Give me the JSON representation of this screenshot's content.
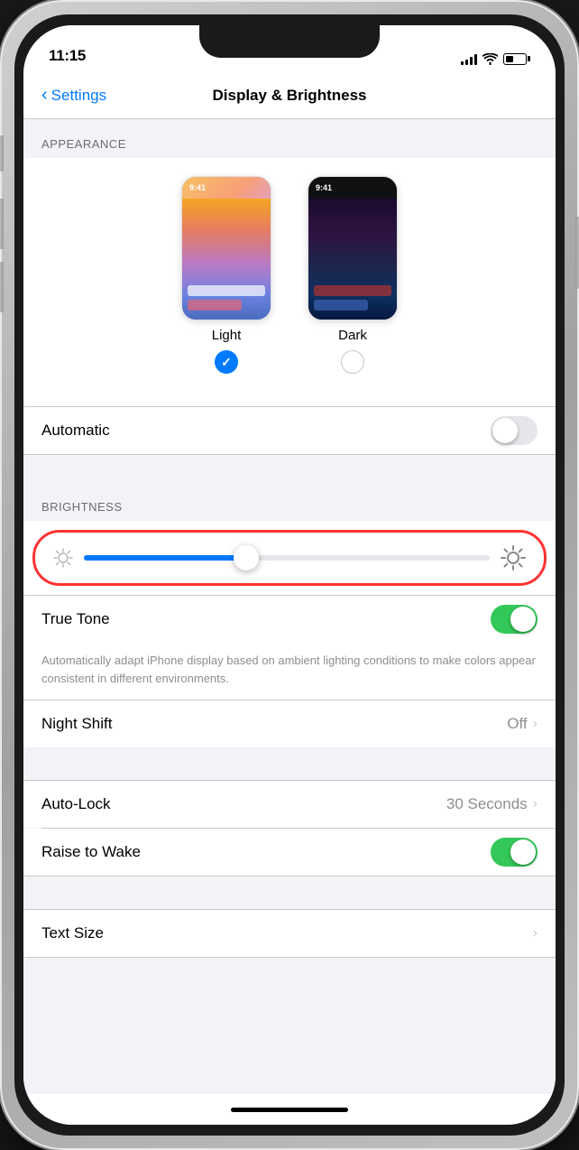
{
  "status_bar": {
    "time": "11:15"
  },
  "nav": {
    "back_label": "Settings",
    "title": "Display & Brightness"
  },
  "sections": {
    "appearance": {
      "header": "APPEARANCE",
      "light_label": "Light",
      "dark_label": "Dark",
      "light_time": "9:41",
      "dark_time": "9:41",
      "light_selected": true,
      "dark_selected": false
    },
    "automatic": {
      "label": "Automatic",
      "enabled": false
    },
    "brightness": {
      "header": "BRIGHTNESS",
      "value": 40
    },
    "true_tone": {
      "label": "True Tone",
      "enabled": true,
      "description": "Automatically adapt iPhone display based on ambient lighting conditions to make colors appear consistent in different environments."
    },
    "night_shift": {
      "label": "Night Shift",
      "value": "Off",
      "has_arrow": true
    },
    "auto_lock": {
      "label": "Auto-Lock",
      "value": "30 Seconds",
      "has_arrow": true
    },
    "raise_to_wake": {
      "label": "Raise to Wake",
      "enabled": true
    },
    "text_size": {
      "label": "Text Size",
      "has_arrow": true
    }
  }
}
